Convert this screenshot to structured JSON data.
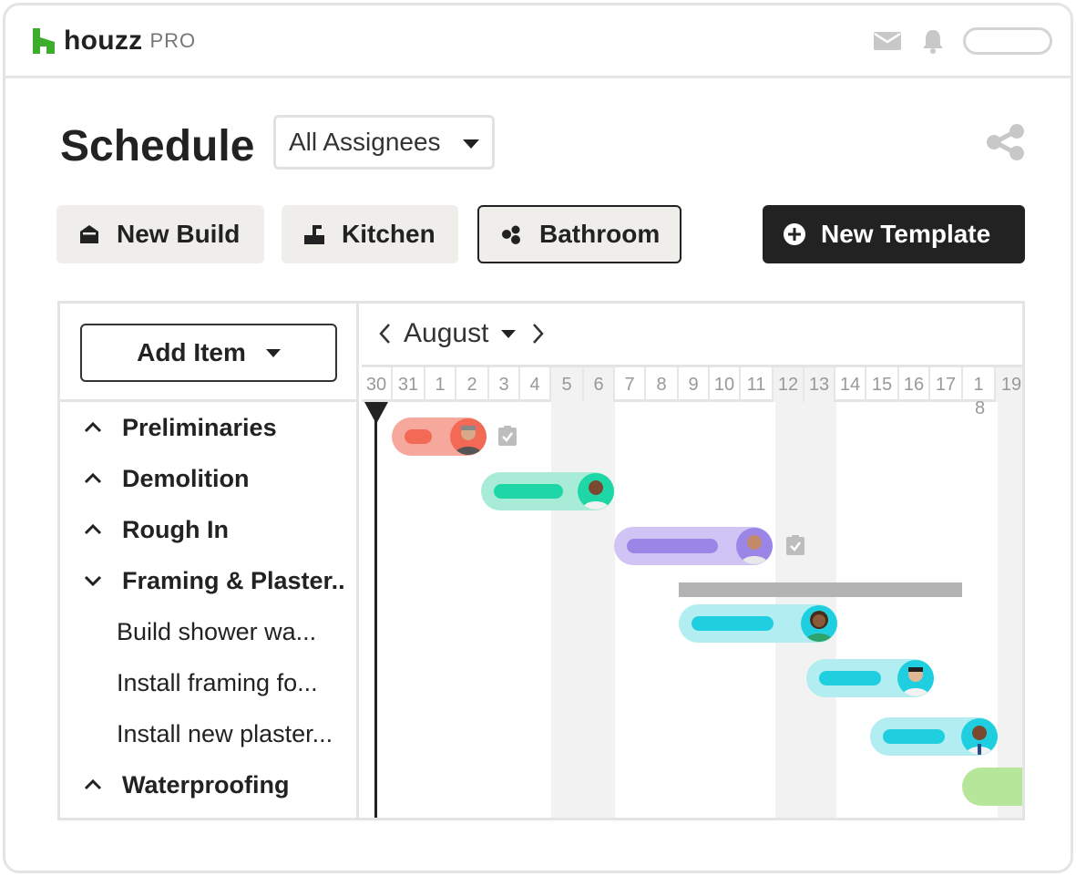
{
  "app": {
    "brand": "houzz",
    "brand_suffix": "PRO",
    "logo_color": "#3dae2b"
  },
  "header_icons": [
    "mail-icon",
    "bell-icon"
  ],
  "page": {
    "title": "Schedule",
    "assignee_filter": "All Assignees"
  },
  "templates": [
    {
      "label": "New Build",
      "icon": "house-icon"
    },
    {
      "label": "Kitchen",
      "icon": "faucet-icon"
    },
    {
      "label": "Bathroom",
      "icon": "bubbles-icon",
      "selected": true
    }
  ],
  "new_template_label": "New Template",
  "schedule": {
    "add_item_label": "Add Item",
    "month": "August",
    "days": [
      "30",
      "31",
      "1",
      "2",
      "3",
      "4",
      "5",
      "6",
      "7",
      "8",
      "9",
      "10",
      "11",
      "12",
      "13",
      "14",
      "15",
      "16",
      "17",
      "1",
      "19"
    ],
    "day_overflow": "8",
    "rows": [
      {
        "label": "Preliminaries",
        "type": "group",
        "expanded": false
      },
      {
        "label": "Demolition",
        "type": "group",
        "expanded": false
      },
      {
        "label": "Rough In",
        "type": "group",
        "expanded": false
      },
      {
        "label": "Framing & Plaster..",
        "type": "group",
        "expanded": true
      },
      {
        "label": "Build shower wa...",
        "type": "task"
      },
      {
        "label": "Install framing fo...",
        "type": "task"
      },
      {
        "label": "Install new plaster...",
        "type": "task"
      },
      {
        "label": "Waterproofing",
        "type": "group",
        "expanded": false
      }
    ]
  },
  "colors": {
    "coral": "#f7a89d",
    "coral_inner": "#f26a55",
    "mint": "#a8ecd8",
    "mint_inner": "#1fd6a6",
    "lavender": "#cfc4f4",
    "lavender_inner": "#9b86e8",
    "cyan": "#b2edf2",
    "cyan_inner": "#1fcfe0",
    "green": "#b5e69a",
    "summary": "#b3b3b3"
  }
}
